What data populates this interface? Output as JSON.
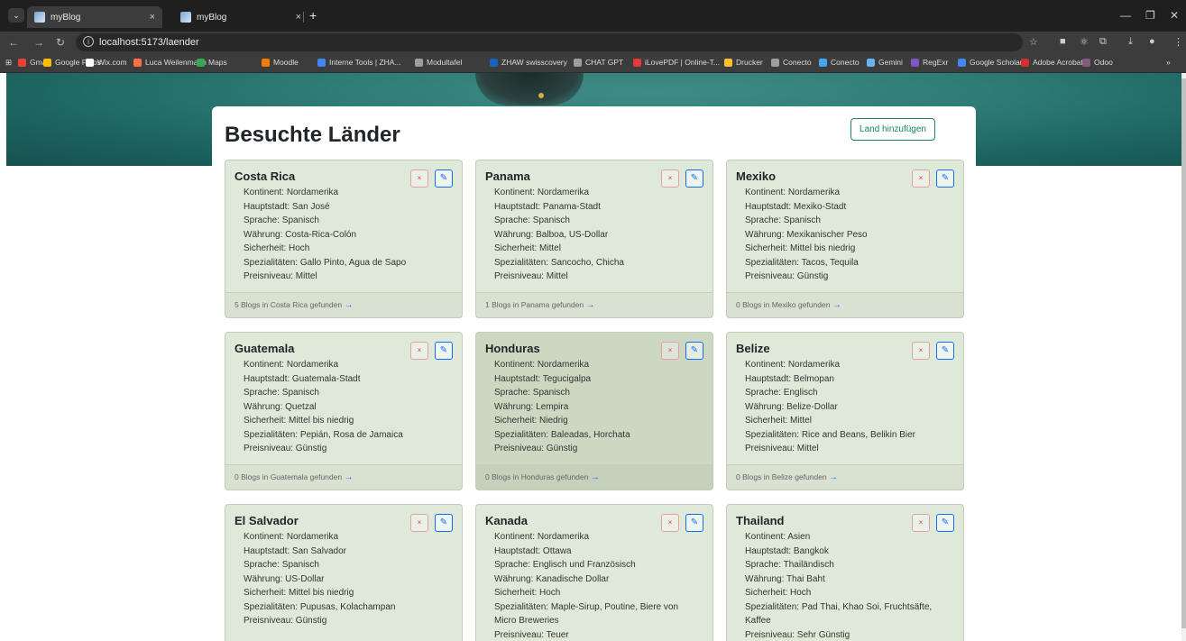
{
  "browser": {
    "tabs": [
      {
        "title": "myBlog",
        "close": "×"
      },
      {
        "title": "myBlog",
        "close": "×"
      }
    ],
    "new_tab": "+",
    "url": "localhost:5173/laender",
    "bookmarks": [
      {
        "label": "Gmail",
        "color": "#ea4335"
      },
      {
        "label": "Google Fotos",
        "color": "#fbbc04"
      },
      {
        "label": "Wix.com",
        "color": "#ffffff"
      },
      {
        "label": "Luca Weilenmann",
        "color": "#ff7043"
      },
      {
        "label": "Maps",
        "color": "#34a853"
      },
      {
        "label": "Moodle",
        "color": "#f57c00"
      },
      {
        "label": "Interne Tools | ZHA...",
        "color": "#4285f4"
      },
      {
        "label": "Modultafel",
        "color": "#9e9e9e"
      },
      {
        "label": "ZHAW swisscovery",
        "color": "#1565c0"
      },
      {
        "label": "CHAT GPT",
        "color": "#9e9e9e"
      },
      {
        "label": "iLovePDF | Online-T...",
        "color": "#e53935"
      },
      {
        "label": "Drucker",
        "color": "#fbc02d"
      },
      {
        "label": "Conecto",
        "color": "#9e9e9e"
      },
      {
        "label": "Conecto",
        "color": "#42a5f5"
      },
      {
        "label": "Gemini",
        "color": "#64b5f6"
      },
      {
        "label": "RegExr",
        "color": "#7e57c2"
      },
      {
        "label": "Google Scholar",
        "color": "#4285f4"
      },
      {
        "label": "Adobe Acrobat",
        "color": "#d32f2f"
      },
      {
        "label": "Odoo",
        "color": "#875a7b"
      }
    ]
  },
  "page": {
    "title": "Besuchte Länder",
    "add_button": "Land hinzufügen",
    "delete_label": "×",
    "edit_label": "✎",
    "arrow": "→",
    "colors": {
      "card_bg": "#dfe9d9",
      "success": "#198754",
      "danger": "#dc3545",
      "primary": "#0d6efd"
    }
  },
  "countries": [
    {
      "name": "Costa Rica",
      "lines": [
        "Kontinent: Nordamerika",
        "Hauptstadt: San José",
        "Sprache: Spanisch",
        "Währung: Costa-Rica-Colón",
        "Sicherheit: Hoch",
        "Spezialitäten: Gallo Pinto, Agua de Sapo",
        "Preisniveau: Mittel"
      ],
      "footer": "5 Blogs in Costa Rica gefunden"
    },
    {
      "name": "Panama",
      "lines": [
        "Kontinent: Nordamerika",
        "Hauptstadt: Panama-Stadt",
        "Sprache: Spanisch",
        "Währung: Balboa, US-Dollar",
        "Sicherheit: Mittel",
        "Spezialitäten: Sancocho, Chicha",
        "Preisniveau: Mittel"
      ],
      "footer": "1 Blogs in Panama gefunden"
    },
    {
      "name": "Mexiko",
      "lines": [
        "Kontinent: Nordamerika",
        "Hauptstadt: Mexiko-Stadt",
        "Sprache: Spanisch",
        "Währung: Mexikanischer Peso",
        "Sicherheit: Mittel bis niedrig",
        "Spezialitäten: Tacos, Tequila",
        "Preisniveau: Günstig"
      ],
      "footer": "0 Blogs in Mexiko gefunden"
    },
    {
      "name": "Guatemala",
      "lines": [
        "Kontinent: Nordamerika",
        "Hauptstadt: Guatemala-Stadt",
        "Sprache: Spanisch",
        "Währung: Quetzal",
        "Sicherheit: Mittel bis niedrig",
        "Spezialitäten: Pepián, Rosa de Jamaica",
        "Preisniveau: Günstig"
      ],
      "footer": "0 Blogs in Guatemala gefunden"
    },
    {
      "name": "Honduras",
      "lines": [
        "Kontinent: Nordamerika",
        "Hauptstadt: Tegucigalpa",
        "Sprache: Spanisch",
        "Währung: Lempira",
        "Sicherheit: Niedrig",
        "Spezialitäten: Baleadas, Horchata",
        "Preisniveau: Günstig"
      ],
      "footer": "0 Blogs in Honduras gefunden"
    },
    {
      "name": "Belize",
      "lines": [
        "Kontinent: Nordamerika",
        "Hauptstadt: Belmopan",
        "Sprache: Englisch",
        "Währung: Belize-Dollar",
        "Sicherheit: Mittel",
        "Spezialitäten: Rice and Beans, Belikin Bier",
        "Preisniveau: Mittel"
      ],
      "footer": "0 Blogs in Belize gefunden"
    },
    {
      "name": "El Salvador",
      "lines": [
        "Kontinent: Nordamerika",
        "Hauptstadt: San Salvador",
        "Sprache: Spanisch",
        "Währung: US-Dollar",
        "Sicherheit: Mittel bis niedrig",
        "Spezialitäten: Pupusas, Kolachampan",
        "Preisniveau: Günstig"
      ],
      "footer": ""
    },
    {
      "name": "Kanada",
      "lines": [
        "Kontinent: Nordamerika",
        "Hauptstadt: Ottawa",
        "Sprache: Englisch und Französisch",
        "Währung: Kanadische Dollar",
        "Sicherheit: Hoch",
        "Spezialitäten: Maple-Sirup, Poutine, Biere von",
        "Micro Breweries",
        "Preisniveau: Teuer"
      ],
      "footer": ""
    },
    {
      "name": "Thailand",
      "lines": [
        "Kontinent: Asien",
        "Hauptstadt: Bangkok",
        "Sprache: Thailändisch",
        "Währung: Thai Baht",
        "Sicherheit: Hoch",
        "Spezialitäten: Pad Thai, Khao Soi, Fruchtsäfte,",
        "Kaffee",
        "Preisniveau: Sehr Günstig"
      ],
      "footer": ""
    }
  ]
}
